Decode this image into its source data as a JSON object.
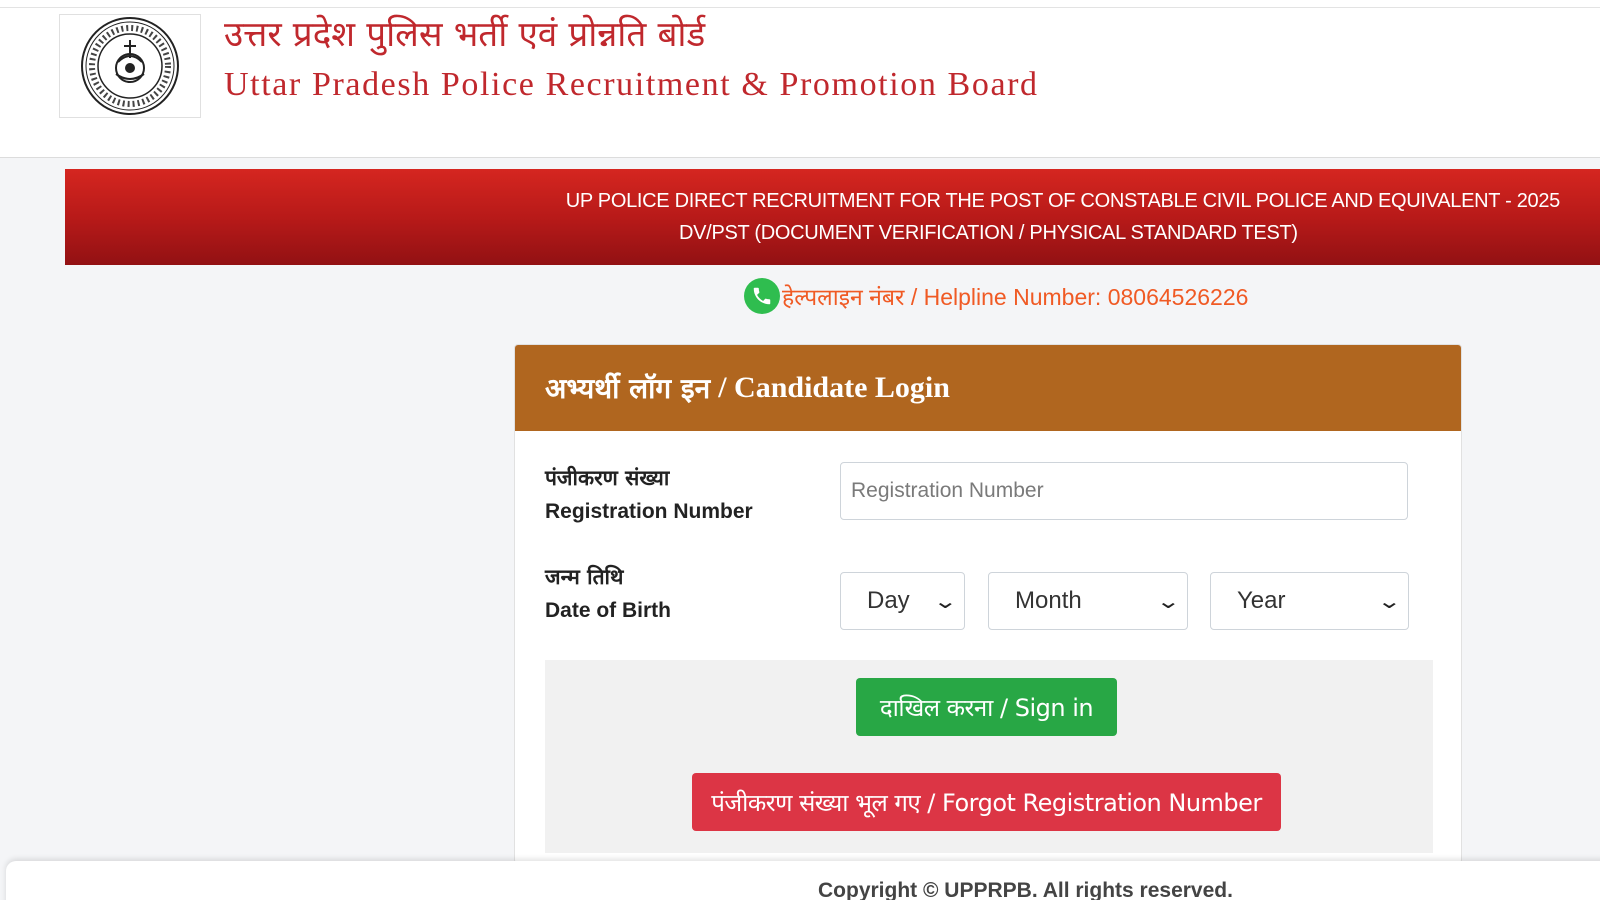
{
  "header": {
    "title_hindi": "उत्तर प्रदेश पुलिस भर्ती एवं प्रोन्नति बोर्ड",
    "title_english": "Uttar Pradesh Police Recruitment & Promotion Board"
  },
  "banner": {
    "line1": "UP POLICE DIRECT RECRUITMENT FOR THE POST OF CONSTABLE CIVIL POLICE AND EQUIVALENT - 2025",
    "line2": "DV/PST (DOCUMENT VERIFICATION / PHYSICAL STANDARD TEST)"
  },
  "helpline": {
    "text": "हेल्पलाइन नंबर / Helpline Number: 08064526226"
  },
  "login": {
    "heading_hindi": "अभ्यर्थी लॉग इन",
    "heading_english": "/ Candidate Login",
    "registration": {
      "label_hindi": "पंजीकरण संख्या",
      "label_english": "Registration Number",
      "placeholder": "Registration Number",
      "value": ""
    },
    "dob": {
      "label_hindi": "जन्म तिथि",
      "label_english": "Date of Birth",
      "day": "Day",
      "month": "Month",
      "year": "Year"
    },
    "signin_label": "दाखिल करना / Sign in",
    "forgot_label": "पंजीकरण संख्या भूल गए / Forgot Registration Number"
  },
  "footer": {
    "copyright": "Copyright © UPPRPB. All rights reserved."
  },
  "colors": {
    "banner_red": "#c0201d",
    "title_red": "#c0282d",
    "card_header": "#b0661f",
    "signin_green": "#28a745",
    "forgot_red": "#dc3545",
    "helpline_orange": "#f05a24"
  },
  "icons": {
    "logo": "upprpb-seal-logo",
    "phone": "phone-icon",
    "dropdown": "chevron-down-icon"
  }
}
